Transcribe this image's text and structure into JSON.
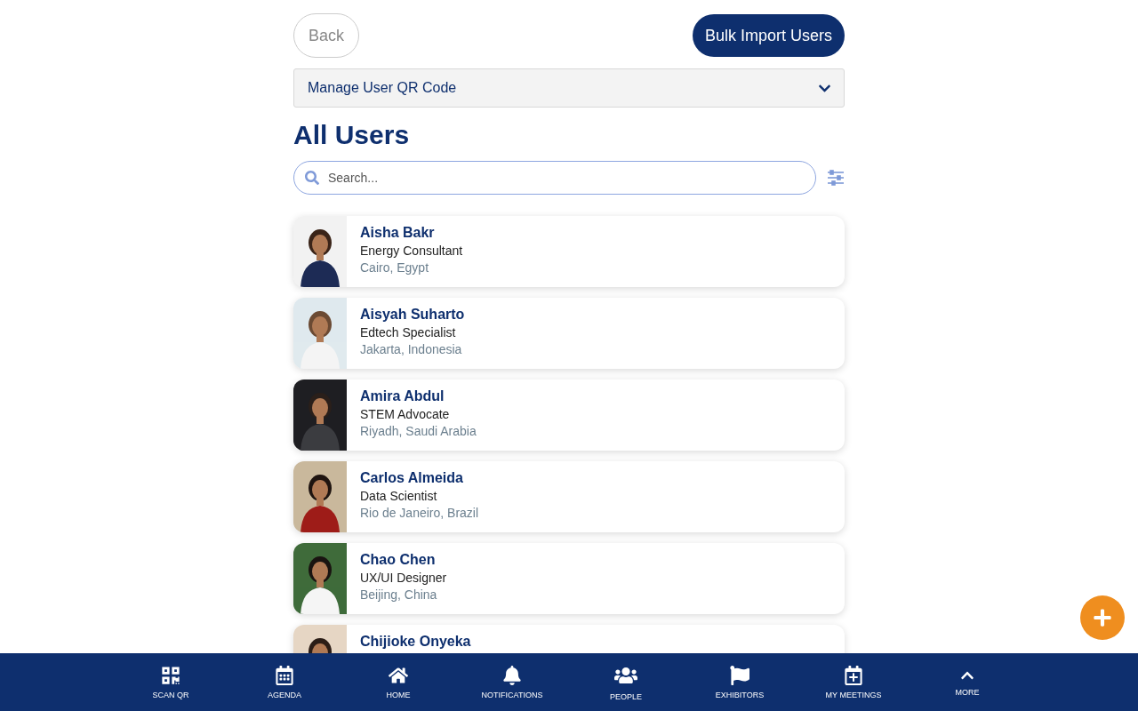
{
  "header": {
    "back": "Back",
    "bulk_import": "Bulk Import Users"
  },
  "accordion": {
    "label": "Manage User QR Code",
    "expanded": false
  },
  "title": "All Users",
  "search": {
    "placeholder": "Search..."
  },
  "users": [
    {
      "name": "Aisha Bakr",
      "role": "Energy Consultant",
      "location": "Cairo, Egypt"
    },
    {
      "name": "Aisyah Suharto",
      "role": "Edtech Specialist",
      "location": "Jakarta, Indonesia"
    },
    {
      "name": "Amira Abdul",
      "role": "STEM Advocate",
      "location": "Riyadh, Saudi Arabia"
    },
    {
      "name": "Carlos Almeida",
      "role": "Data Scientist",
      "location": "Rio de Janeiro, Brazil"
    },
    {
      "name": "Chao Chen",
      "role": "UX/UI Designer",
      "location": "Beijing, China"
    },
    {
      "name": "Chijioke Onyeka"
    }
  ],
  "nav": [
    {
      "kind": "qr",
      "label": "SCAN QR"
    },
    {
      "kind": "calendar",
      "label": "AGENDA"
    },
    {
      "kind": "home",
      "label": "HOME"
    },
    {
      "kind": "bell",
      "label": "NOTIFICATIONS"
    },
    {
      "kind": "people",
      "label": "PEOPLE"
    },
    {
      "kind": "flag",
      "label": "EXHIBITORS"
    },
    {
      "kind": "calendar-plus",
      "label": "MY MEETINGS"
    },
    {
      "kind": "up",
      "label": "MORE"
    }
  ]
}
